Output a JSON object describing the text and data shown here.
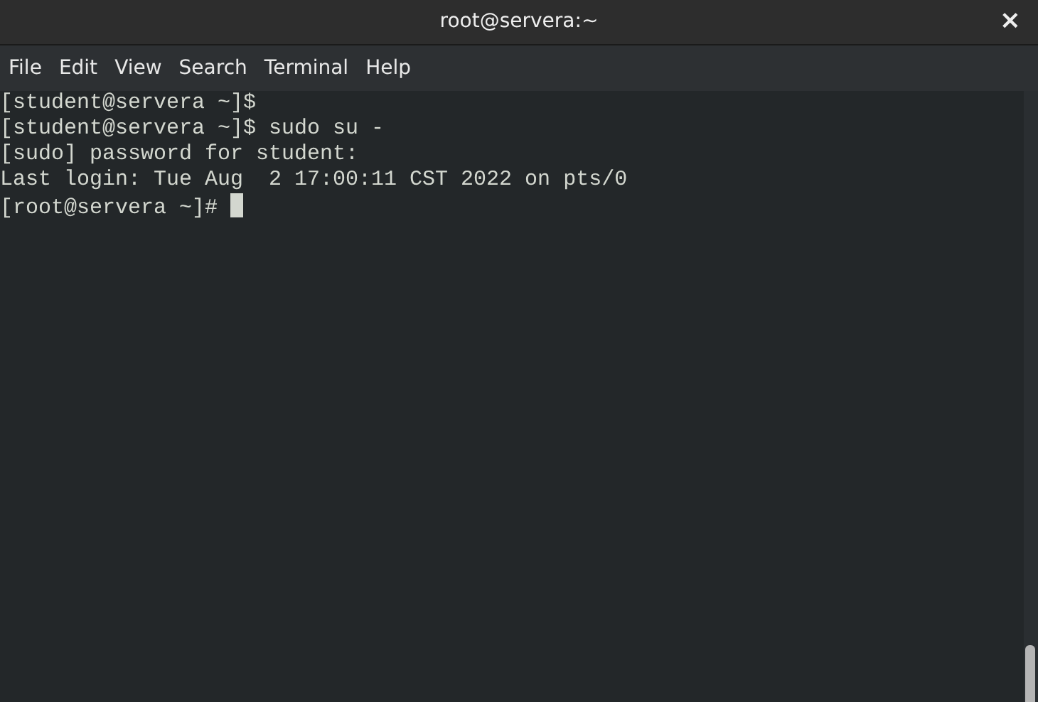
{
  "window": {
    "title": "root@servera:~",
    "close": "×"
  },
  "menu": [
    "File",
    "Edit",
    "View",
    "Search",
    "Terminal",
    "Help"
  ],
  "terminal": {
    "lines": [
      "[student@servera ~]$",
      "[student@servera ~]$ sudo su -",
      "[sudo] password for student:",
      "Last login: Tue Aug  2 17:00:11 CST 2022 on pts/0",
      "[root@servera ~]# "
    ]
  }
}
